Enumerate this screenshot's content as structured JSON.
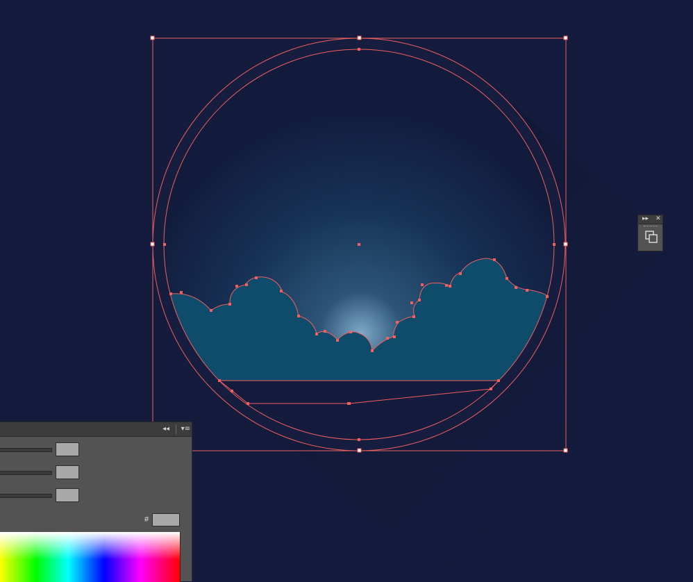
{
  "colors": {
    "canvas_bg": "#141b3c",
    "selection": "#f06060",
    "cloud_fill": "#0f4b6a",
    "panel_bg": "#535353",
    "panel_bar": "#3c3c3c",
    "field_bg": "#a9a9a9"
  },
  "mini_panel": {
    "expand_icon": "double-chevron-right-icon",
    "close_icon": "close-icon",
    "tool_icon": "arrange-layers-icon",
    "expand_glyph": "▸▸",
    "close_glyph": "✕"
  },
  "color_panel": {
    "collapse_glyph": "◂◂",
    "menu_glyph": "▾≡",
    "hex_label": "#",
    "hex_value": "",
    "sliders": [
      "",
      "",
      ""
    ]
  }
}
